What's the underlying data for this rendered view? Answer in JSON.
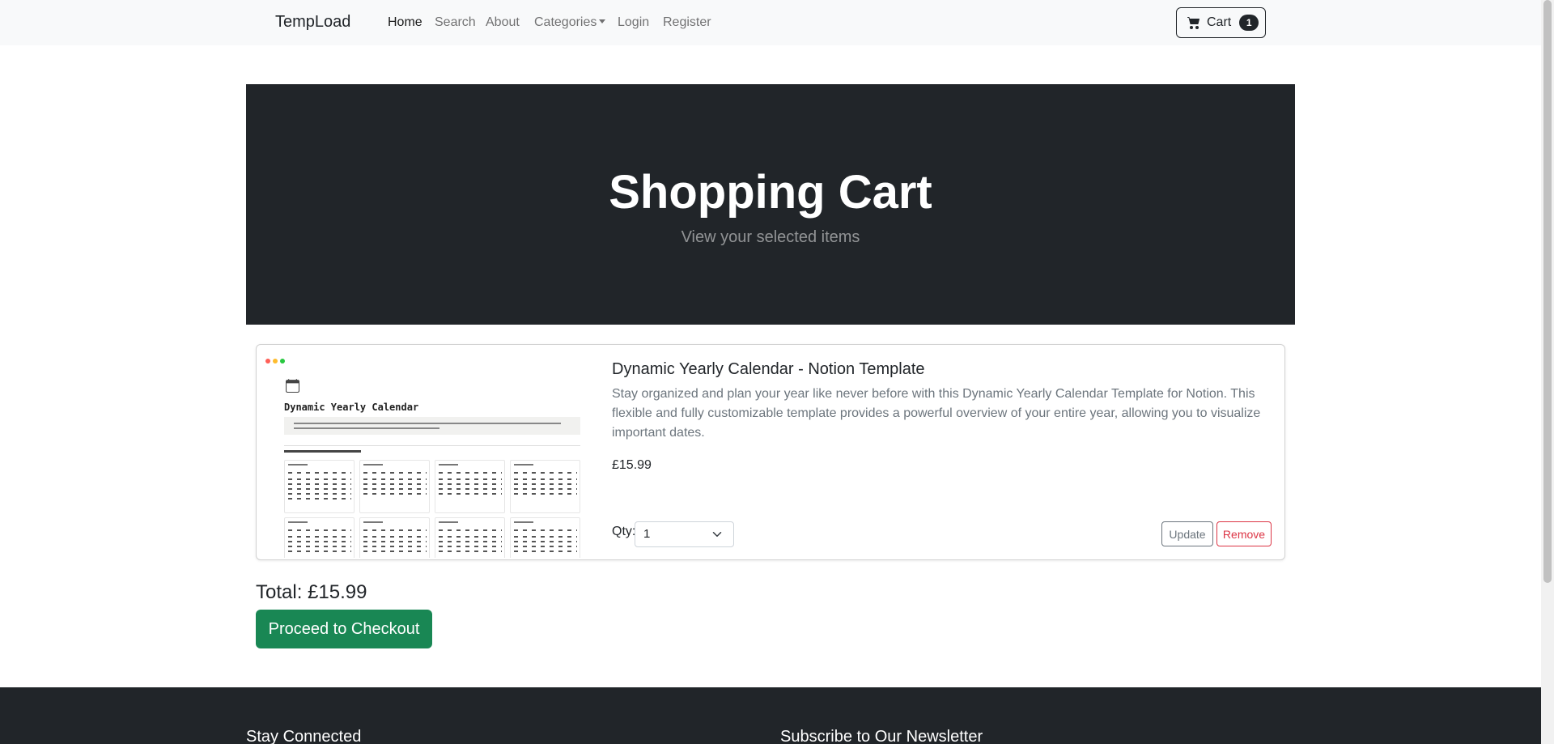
{
  "navbar": {
    "brand": "TempLoad",
    "links": [
      {
        "label": "Home",
        "active": true
      },
      {
        "label": "Search"
      },
      {
        "label": "About"
      },
      {
        "label": "Categories"
      },
      {
        "label": "Login"
      },
      {
        "label": "Register"
      }
    ],
    "cart": {
      "label": "Cart",
      "count": "1",
      "icon": "cart-icon"
    }
  },
  "hero": {
    "title": "Shopping Cart",
    "subtitle": "View your selected items"
  },
  "cart_items": [
    {
      "thumbnail": {
        "title": "Dynamic Yearly Calendar",
        "icon": "calendar-icon"
      },
      "title": "Dynamic Yearly Calendar - Notion Template",
      "description": "Stay organized and plan your year like never before with this Dynamic Yearly Calendar Template for Notion. This flexible and fully customizable template provides a powerful overview of your entire year, allowing you to visualize important dates.",
      "price": "£15.99",
      "qty_label": "Qty:",
      "qty_value": "1",
      "update_label": "Update",
      "remove_label": "Remove"
    }
  ],
  "summary": {
    "total": "Total: £15.99",
    "checkout_label": "Proceed to Checkout"
  },
  "footer": {
    "left_heading": "Stay Connected",
    "right_heading": "Subscribe to Our Newsletter"
  },
  "colors": {
    "dark": "#212529",
    "success": "#198754",
    "danger": "#dc3545",
    "secondary": "#6c757d",
    "navbar_bg": "#f8f9fa"
  }
}
